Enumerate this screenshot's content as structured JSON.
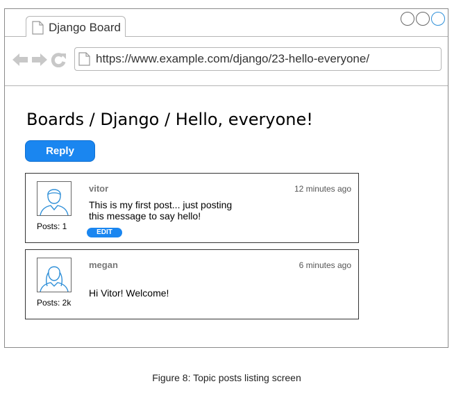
{
  "tab": {
    "title": "Django Board",
    "icon": "document-icon"
  },
  "address_bar": {
    "url": "https://www.example.com/django/23-hello-everyone/"
  },
  "page": {
    "breadcrumb": "Boards / Django / Hello, everyone!",
    "reply_label": "Reply"
  },
  "posts": [
    {
      "author": "vitor",
      "time": "12 minutes ago",
      "message": "This is my first post... just posting\nthis message to say hello!",
      "posts_count": "Posts: 1",
      "edit_label": "EDIT"
    },
    {
      "author": "megan",
      "time": "6 minutes ago",
      "message": "Hi Vitor! Welcome!",
      "posts_count": "Posts: 2k"
    }
  ],
  "caption": "Figure 8: Topic posts listing screen",
  "colors": {
    "accent": "#1a86f0",
    "nav_icon": "#c8c8c8",
    "avatar_stroke": "#2e8fd8"
  }
}
